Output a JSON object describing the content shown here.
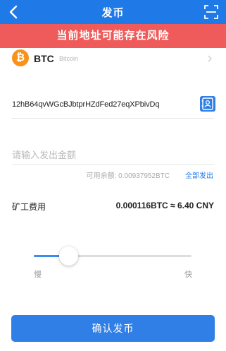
{
  "header": {
    "title": "发币",
    "back_icon": "chevron-left-icon",
    "scan_icon": "scan-icon",
    "color": "#1f7ae8"
  },
  "risk_banner": {
    "text": "当前地址可能存在风险",
    "color": "#ef5a5a"
  },
  "coin": {
    "symbol": "BTC",
    "name": "Bitcoin",
    "icon": "bitcoin-icon",
    "icon_glyph": "₿",
    "icon_color": "#f7931a"
  },
  "address": {
    "value": "12hB64qvWGcBJbtprHZdFed27eqXPbivDq",
    "contact_icon": "address-book-icon"
  },
  "amount": {
    "placeholder": "请输入发出金额",
    "balance_text": "可用余额: 0.00937952BTC",
    "send_all_label": "全部发出"
  },
  "fee": {
    "label": "矿工费用",
    "value": "0.000116BTC ≈ 6.40 CNY"
  },
  "speed": {
    "slow_label": "慢",
    "fast_label": "快",
    "level": 0.22
  },
  "confirm": {
    "label": "确认发币",
    "color": "#2f7fe6"
  }
}
